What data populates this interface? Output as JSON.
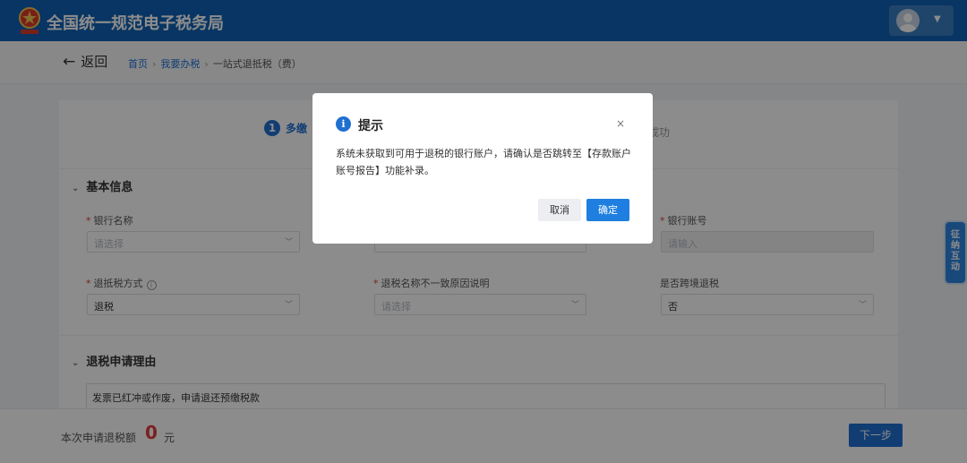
{
  "header": {
    "site_title": "全国统一规范电子税务局"
  },
  "breadcrumb": {
    "back_label": "返回",
    "items": [
      "首页",
      "我要办税",
      "一站式退抵税（费）"
    ]
  },
  "steps": {
    "step1_num": "1",
    "step1_label": "多缴",
    "step_end_label": "成功"
  },
  "basic_info": {
    "title": "基本信息",
    "bank_name_label": "银行名称",
    "bank_name_placeholder": "请选择",
    "bank_account_label": "银行账号",
    "bank_account_placeholder": "请输入",
    "refund_method_label": "退抵税方式",
    "refund_method_value": "退税",
    "mismatch_reason_label": "退税名称不一致原因说明",
    "mismatch_reason_placeholder": "请选择",
    "cross_border_label": "是否跨境退税",
    "cross_border_value": "否"
  },
  "reason_section": {
    "title": "退税申请理由",
    "value": "发票已红冲或作废，申请退还预缴税款"
  },
  "footer": {
    "amount_label": "本次申请退税额",
    "amount_value": "0",
    "amount_unit": "元",
    "next_label": "下一步"
  },
  "side_tab": {
    "label": "征纳互动"
  },
  "modal": {
    "icon": "i",
    "title": "提示",
    "close": "×",
    "body": "系统未获取到可用于退税的银行账户，请确认是否跳转至【存款账户账号报告】功能补录。",
    "cancel_label": "取消",
    "ok_label": "确定"
  },
  "colors": {
    "header_bg": "#0f62b5",
    "primary": "#1f6fd1",
    "required": "#e23b3b"
  }
}
